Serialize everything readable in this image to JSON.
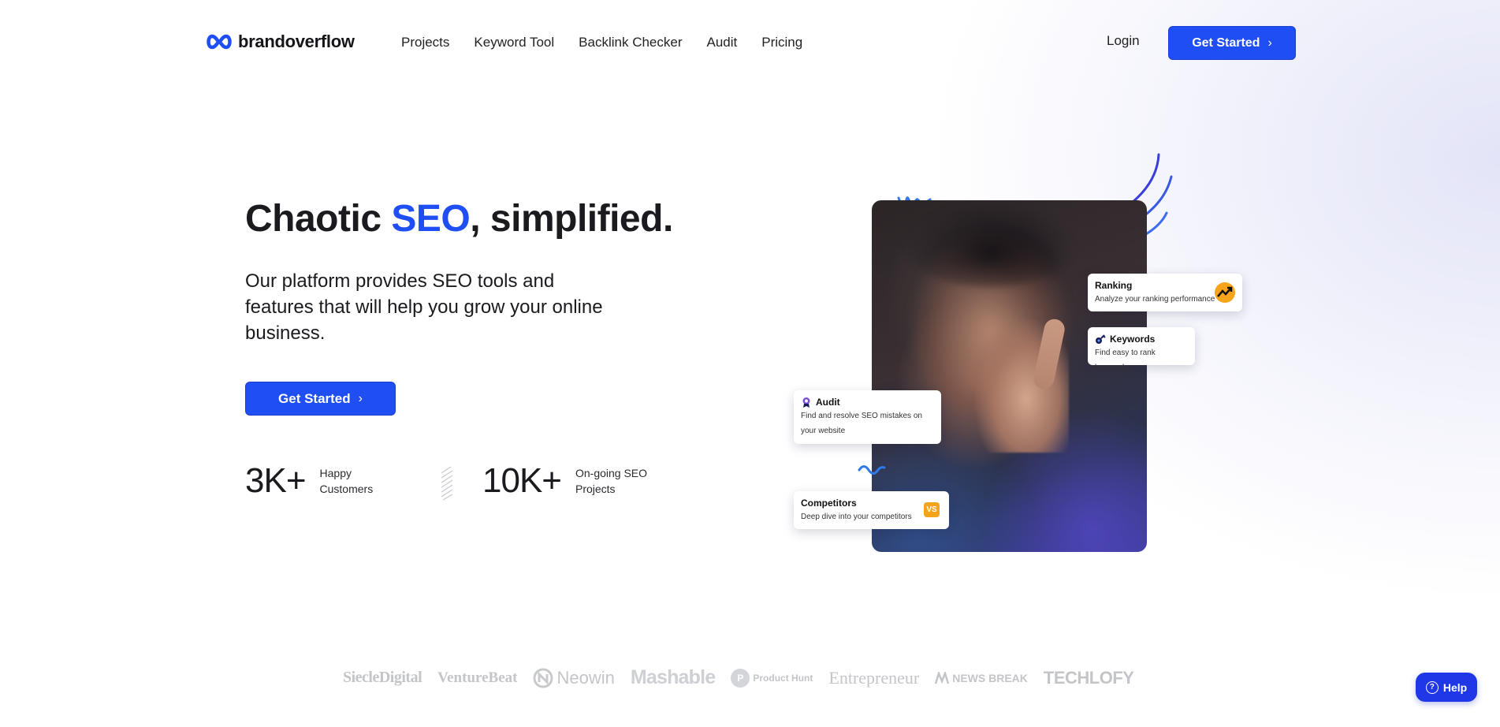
{
  "brand": {
    "name": "brandoverflow",
    "accent": "#1f4ef5"
  },
  "nav": {
    "items": [
      "Projects",
      "Keyword Tool",
      "Backlink Checker",
      "Audit",
      "Pricing"
    ],
    "login": "Login",
    "cta": "Get Started",
    "cta_icon": "chevron-right-icon"
  },
  "hero": {
    "title_pre": "Chaotic ",
    "title_accent": "SEO",
    "title_post": ", simplified.",
    "subtitle": "Our platform provides SEO tools and features that will help you grow your online business.",
    "cta": "Get Started",
    "stats": [
      {
        "value": "3K+",
        "label": "Happy Customers"
      },
      {
        "value": "10K+",
        "label": "On-going SEO Projects"
      }
    ]
  },
  "cards": {
    "ranking": {
      "title": "Ranking",
      "desc": "Analyze your ranking performance",
      "icon": "trend-up-icon"
    },
    "keywords": {
      "title": "Keywords",
      "desc": "Find easy to rank keywords",
      "icon": "key-icon"
    },
    "audit": {
      "title": "Audit",
      "desc": "Find and resolve SEO mistakes on your website",
      "icon": "award-icon"
    },
    "competitors": {
      "title": "Competitors",
      "desc": "Deep dive into your competitors",
      "badge": "VS"
    }
  },
  "press_logos": [
    "SiecleDigital",
    "VentureBeat",
    "Neowin",
    "Mashable",
    "Product Hunt",
    "Entrepreneur",
    "NEWS BREAK",
    "TECHLOFY"
  ],
  "help": {
    "label": "Help",
    "icon": "question-icon"
  }
}
